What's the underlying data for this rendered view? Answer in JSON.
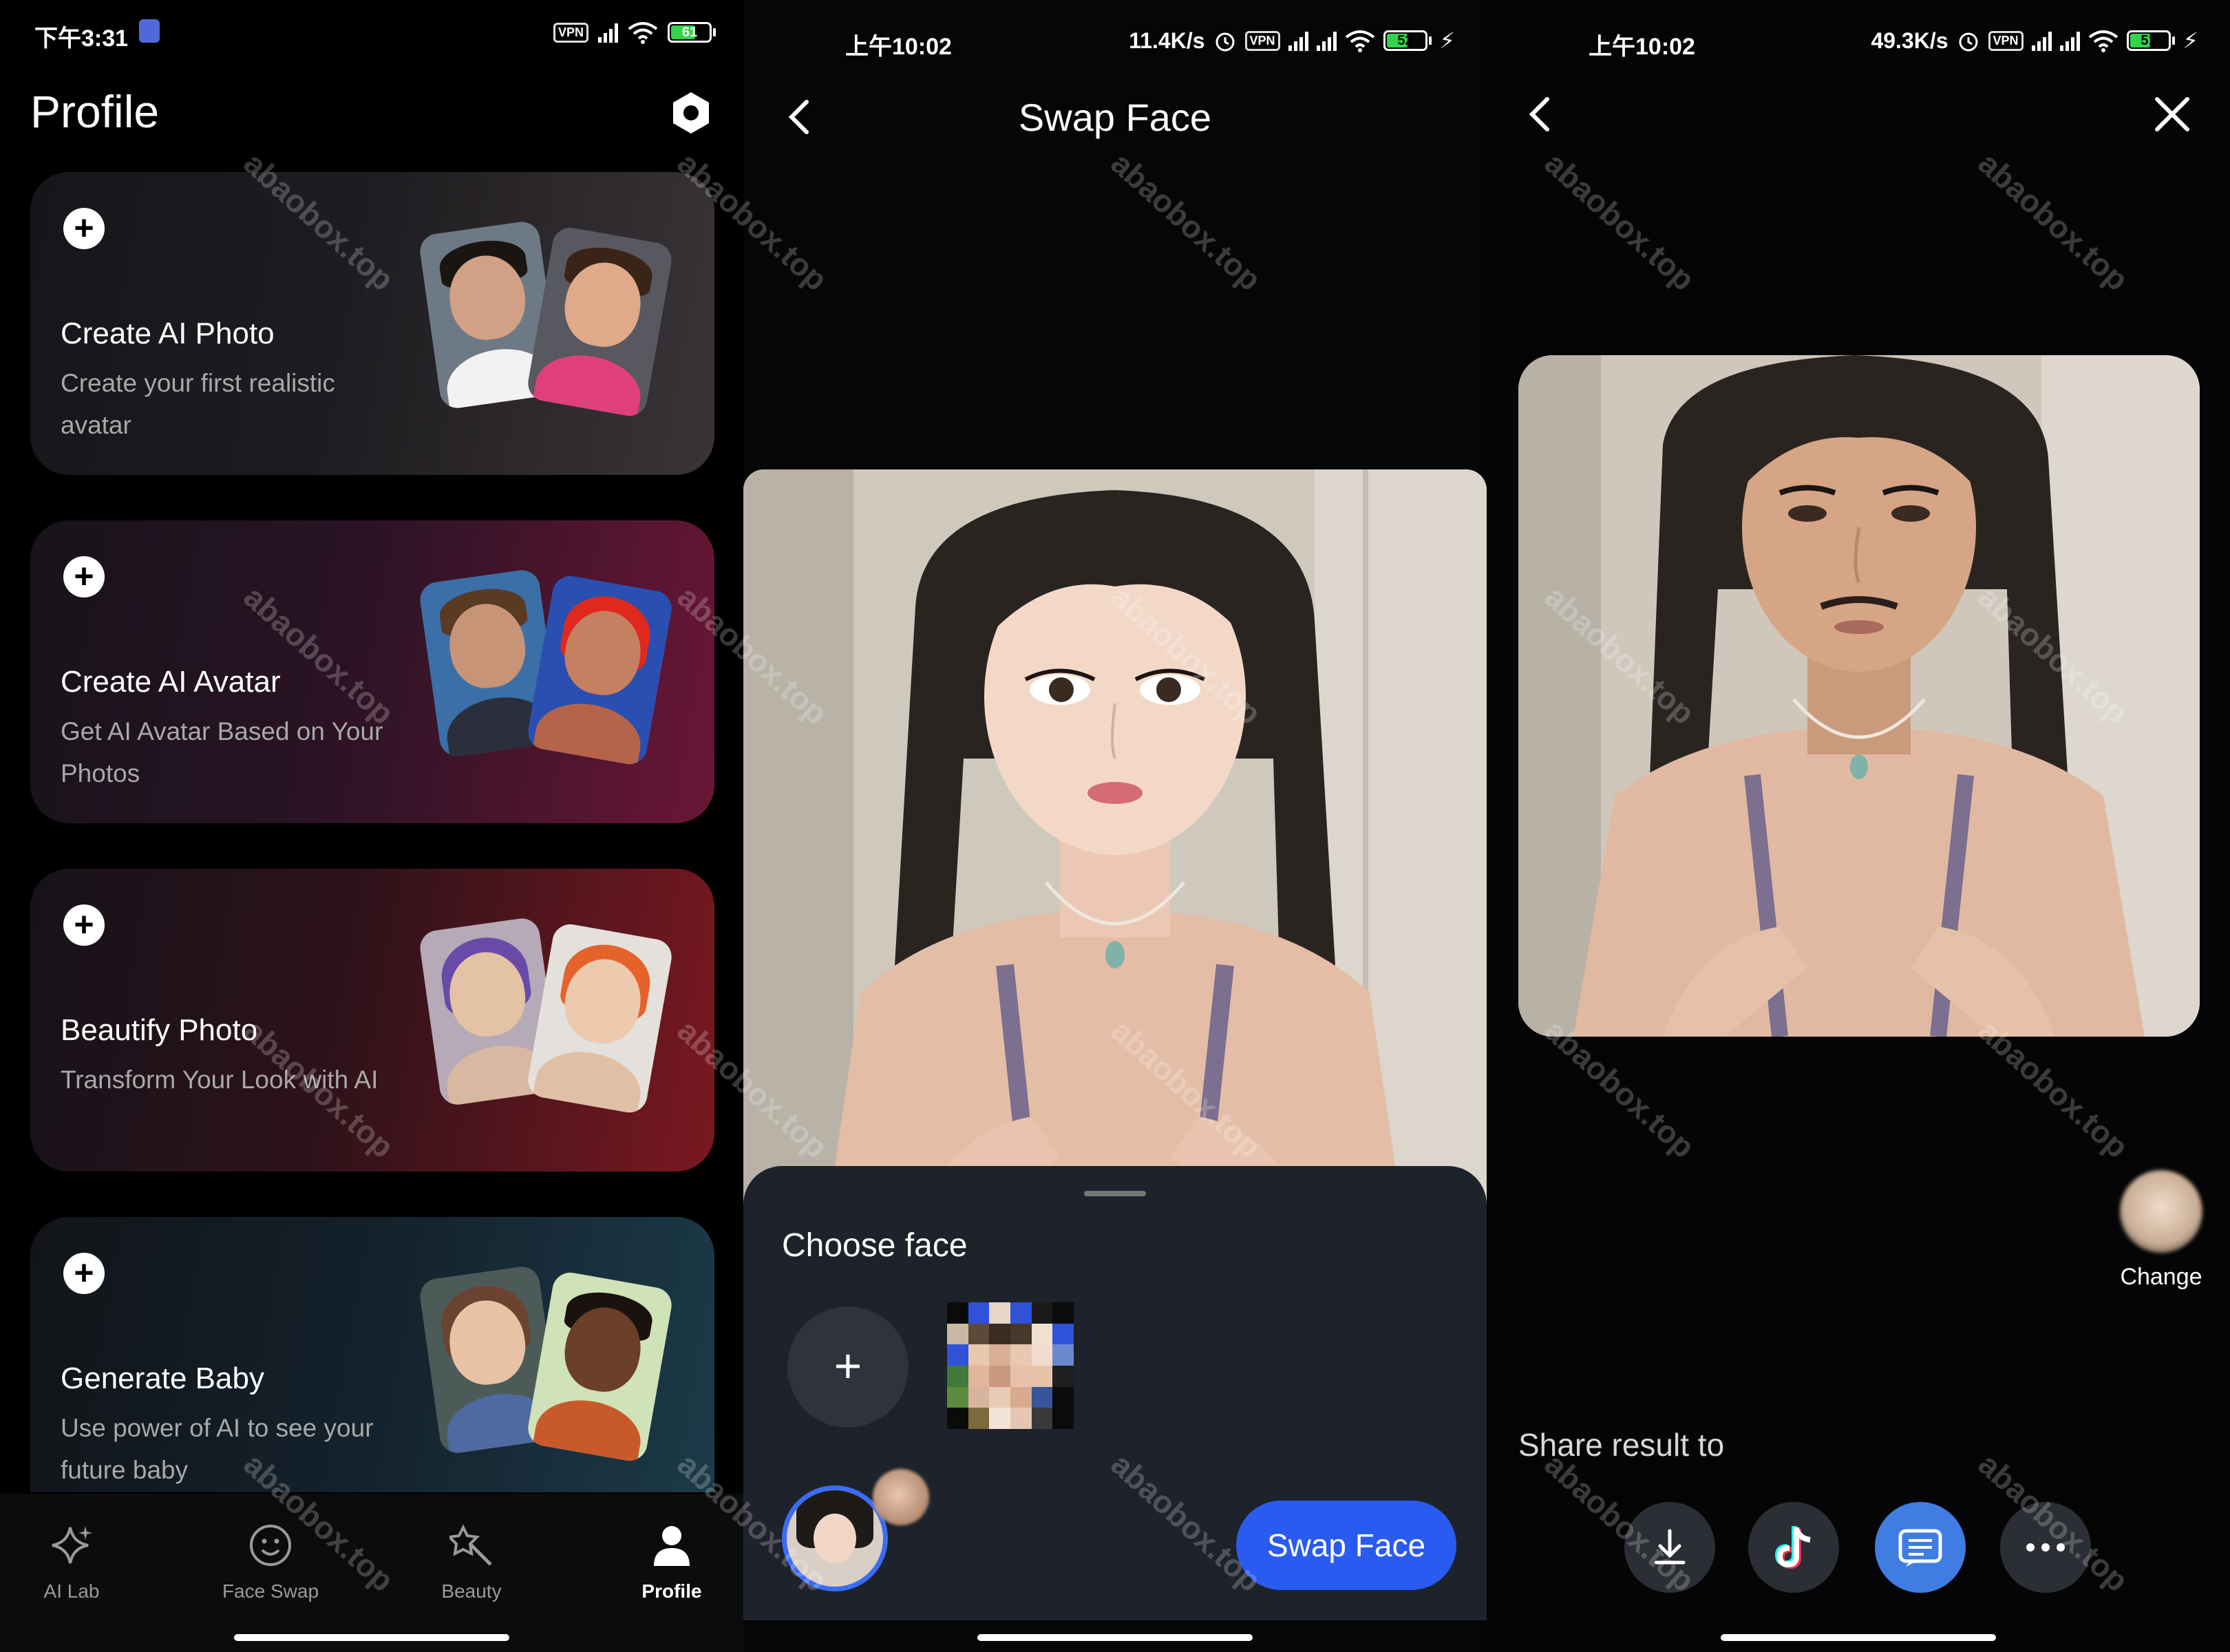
{
  "panel1": {
    "status": {
      "time": "下午3:31",
      "vpn": "VPN",
      "battery": "61",
      "battery_level": 0.61
    },
    "title": "Profile",
    "cards": [
      {
        "title": "Create AI Photo",
        "subtitle": "Create your first realistic avatar"
      },
      {
        "title": "Create AI Avatar",
        "subtitle": "Get AI Avatar Based on Your Photos"
      },
      {
        "title": "Beautify Photo",
        "subtitle": "Transform Your Look with AI"
      },
      {
        "title": "Generate Baby",
        "subtitle": "Use power of AI to see your future baby"
      }
    ],
    "nav": [
      {
        "label": "AI Lab",
        "icon": "sparkle-icon"
      },
      {
        "label": "Face Swap",
        "icon": "smile-face-icon"
      },
      {
        "label": "Beauty",
        "icon": "magic-wand-icon"
      },
      {
        "label": "Profile",
        "icon": "person-icon",
        "active": true
      }
    ]
  },
  "panel2": {
    "status": {
      "time": "上午10:02",
      "speed": "11.4K/s",
      "vpn": "VPN",
      "battery": "52",
      "battery_level": 0.52
    },
    "title": "Swap Face",
    "choose_face": "Choose face",
    "add_symbol": "+",
    "button": "Swap Face"
  },
  "panel3": {
    "status": {
      "time": "上午10:02",
      "speed": "49.3K/s",
      "vpn": "VPN",
      "battery": "51",
      "battery_level": 0.51
    },
    "change_label": "Change",
    "share_label": "Share result to",
    "share_buttons": [
      {
        "icon": "download-icon"
      },
      {
        "icon": "tiktok-icon"
      },
      {
        "icon": "message-icon"
      },
      {
        "icon": "more-icon"
      }
    ]
  },
  "watermark": "abaobox.top",
  "colors": {
    "accent": "#2a5bf0",
    "battery_green": "#33d34a",
    "sheet_bg": "#1e222a"
  }
}
